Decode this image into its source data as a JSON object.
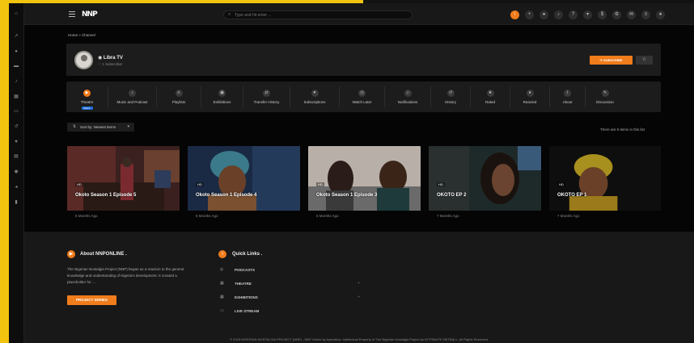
{
  "colors": {
    "accent": "#f07c1b",
    "frame": "#f2c40f",
    "badge": "#1e6bd6"
  },
  "sidebar": {
    "icons": [
      "home-icon",
      "trending-icon",
      "user-icon",
      "film-icon",
      "music-icon",
      "grid-icon",
      "tv-icon",
      "history-icon",
      "heart-icon",
      "book-icon",
      "user-circle-icon",
      "volume-icon",
      "bar-chart-icon"
    ]
  },
  "topbar": {
    "logo": "NNP",
    "search_placeholder": "Type and hit enter ...",
    "icons": [
      "upload-icon",
      "plus-icon",
      "user-icon",
      "bell-icon",
      "help-icon",
      "cart-icon",
      "dollar-icon",
      "settings-icon",
      "message-icon",
      "menu-icon",
      "profile-icon"
    ]
  },
  "breadcrumb": {
    "home": "Home",
    "sep": "»",
    "current": "Channel"
  },
  "channel": {
    "name": "Libra TV",
    "subscribers": "1 Subscriber",
    "subscribe_label": "SUBSCRIBE"
  },
  "tabs": [
    {
      "label": "Theatre",
      "icon": "play-icon",
      "active": true,
      "badge": "Watch"
    },
    {
      "label": "Music and Podcast",
      "icon": "music-icon"
    },
    {
      "label": "Playlists",
      "icon": "list-icon"
    },
    {
      "label": "Exhibitions",
      "icon": "image-icon"
    },
    {
      "label": "Transfer History",
      "icon": "swap-icon"
    },
    {
      "label": "Subscriptions",
      "icon": "heart-icon"
    },
    {
      "label": "Watch Later",
      "icon": "clock-icon"
    },
    {
      "label": "Notifications",
      "icon": "bell-icon"
    },
    {
      "label": "History",
      "icon": "history-icon"
    },
    {
      "label": "Rated",
      "icon": "star-icon"
    },
    {
      "label": "Reacted",
      "icon": "thumb-icon"
    },
    {
      "label": "About",
      "icon": "info-icon"
    },
    {
      "label": "Discussion",
      "icon": "chat-icon"
    }
  ],
  "sort": {
    "label": "Sort by: Newest Items"
  },
  "item_count": "There are 5 items in this list",
  "videos": [
    {
      "title": "Okoto Season 1 Episode 5",
      "age": "6 Months Ago",
      "quality": "HD"
    },
    {
      "title": "Okoto Season 1 Episode 4",
      "age": "6 Months Ago",
      "quality": "HD"
    },
    {
      "title": "Okoto Season 1 Episode 3",
      "age": "6 Months Ago",
      "quality": "HD"
    },
    {
      "title": "OKOTO EP 2",
      "age": "7 Months Ago",
      "quality": "HD"
    },
    {
      "title": "OKOTO EP 1",
      "age": "7 Months Ago",
      "quality": "HD"
    }
  ],
  "footer": {
    "about_title": "About NNPONLINE .",
    "about_text": "The Nigerian Nostalgia Project (NNP) began as a reaction to the general knowledge and understanding of Nigeria's development. It created a placeholder for ...",
    "about_button": "PROJECT SERIES",
    "links_title": "Quick Links .",
    "links": [
      {
        "label": "PODCASTS",
        "icon": "mic-icon",
        "has_children": false
      },
      {
        "label": "THEATRE",
        "icon": "grid-icon",
        "has_children": true
      },
      {
        "label": "EXHIBITIONS",
        "icon": "grid-icon",
        "has_children": true
      },
      {
        "label": "LIVE STREAM",
        "icon": "monitor-icon",
        "has_children": false
      }
    ],
    "copyright": "© 2023 NIGERIAN NOSTALGIA PROJECT (NNP) - NNP Online by byteafrica. Intellectual Property of The Nigerian Nostalgia Project by ATTRIBUTE NETBALL. All Rights Reserved."
  }
}
